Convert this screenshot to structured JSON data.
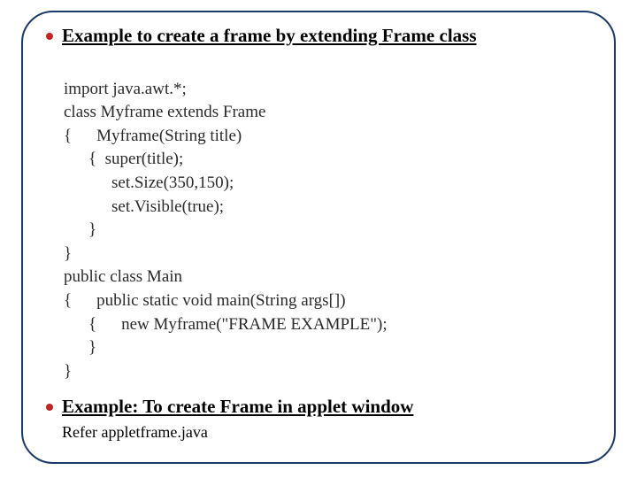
{
  "heading1": "Example to create a frame by extending Frame class",
  "code": {
    "l1": "import java.awt.*;",
    "l2": "class Myframe extends Frame",
    "l3": "{",
    "l3b": "Myframe(String title)",
    "l4a": "{",
    "l4b": "super(title);",
    "l5": "set.Size(350,150);",
    "l6": "set.Visible(true);",
    "l7": "}",
    "l8": "}",
    "l9": "public class Main",
    "l10": "{",
    "l10b": "public static void main(String args[])",
    "l11a": "{",
    "l11b": "new Myframe(\"FRAME EXAMPLE\");",
    "l12": "}",
    "l13": "}"
  },
  "heading2": "Example: To create Frame in applet window",
  "refer": "Refer appletframe.java"
}
